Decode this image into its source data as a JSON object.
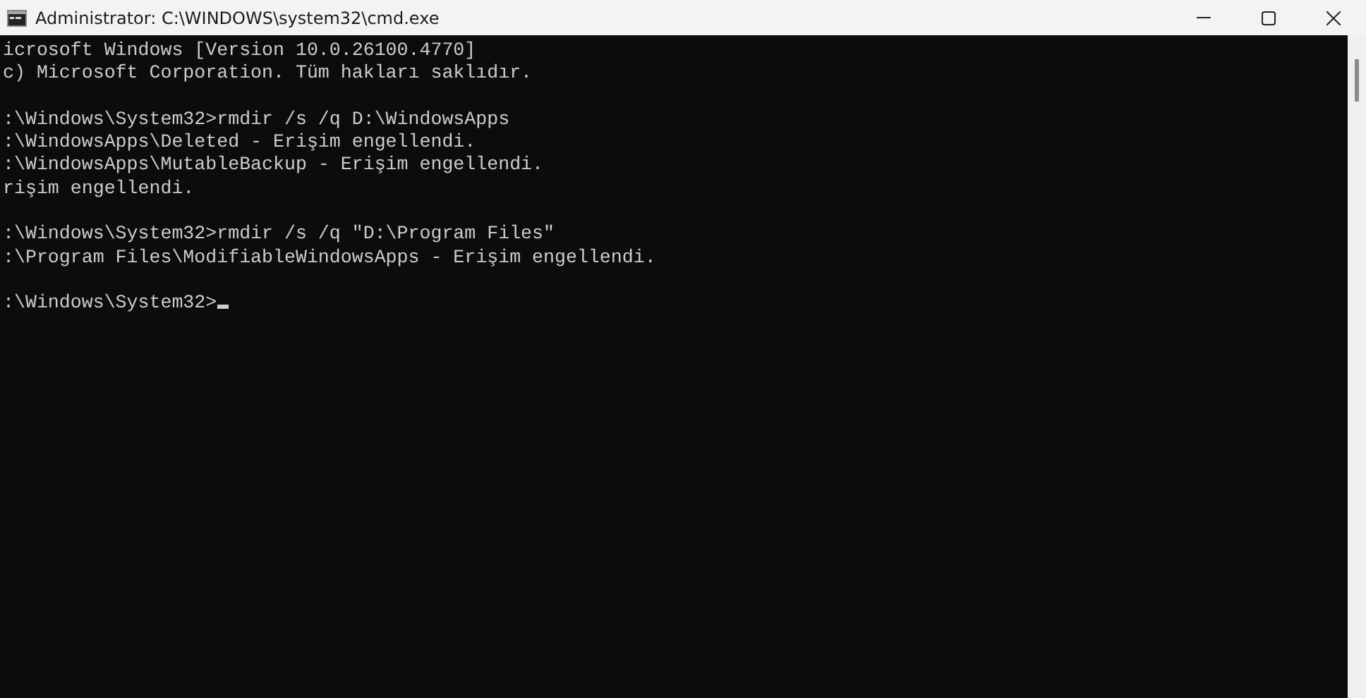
{
  "window": {
    "title": "Administrator: C:\\WINDOWS\\system32\\cmd.exe"
  },
  "console": {
    "lines": [
      {
        "kind": "text",
        "text": "icrosoft Windows [Version 10.0.26100.4770]"
      },
      {
        "kind": "text",
        "text": "c) Microsoft Corporation. Tüm hakları saklıdır."
      },
      {
        "kind": "blank"
      },
      {
        "kind": "text",
        "text": ":\\Windows\\System32>rmdir /s /q D:\\WindowsApps"
      },
      {
        "kind": "text",
        "text": ":\\WindowsApps\\Deleted - Erişim engellendi."
      },
      {
        "kind": "text",
        "text": ":\\WindowsApps\\MutableBackup - Erişim engellendi."
      },
      {
        "kind": "text",
        "text": "rişim engellendi."
      },
      {
        "kind": "blank"
      },
      {
        "kind": "text",
        "text": ":\\Windows\\System32>rmdir /s /q \"D:\\Program Files\""
      },
      {
        "kind": "text",
        "text": ":\\Program Files\\ModifiableWindowsApps - Erişim engellendi."
      },
      {
        "kind": "blank"
      },
      {
        "kind": "text",
        "text": ":\\Windows\\System32>",
        "cursor": true
      }
    ]
  }
}
